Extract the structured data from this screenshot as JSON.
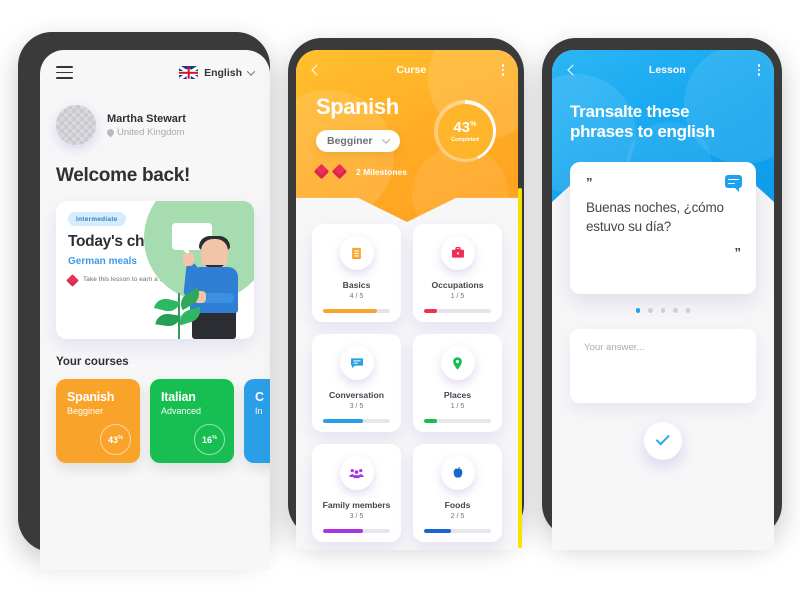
{
  "home": {
    "menu_icon": "hamburger-icon",
    "language": {
      "flag": "uk-flag-icon",
      "label": "English",
      "chevron": "chevron-down-icon"
    },
    "profile": {
      "name": "Martha Stewart",
      "location": "United Kingdom",
      "pin_icon": "location-pin-icon",
      "avatar": "avatar-placeholder"
    },
    "welcome_title": "Welcome back!",
    "challenge": {
      "badge": "Intermediate",
      "title": "Today's challenge",
      "subject": "German meals",
      "note": "Take this lesson to earn a new milestone",
      "note_icon": "gem-icon"
    },
    "courses_title": "Your courses",
    "courses": [
      {
        "name": "Spanish",
        "level": "Begginer",
        "percent": "43",
        "percent_sign": "%",
        "color": "#f9a32b"
      },
      {
        "name": "Italian",
        "level": "Advanced",
        "percent": "16",
        "percent_sign": "%",
        "color": "#17bf53"
      },
      {
        "name": "C",
        "level": "In",
        "percent": "",
        "percent_sign": "",
        "color": "#2a9fe8"
      }
    ]
  },
  "course": {
    "back_icon": "chevron-left-icon",
    "title": "Curse",
    "menu_icon": "more-vertical-icon",
    "language": "Spanish",
    "level": "Begginer",
    "level_chevron": "chevron-down-icon",
    "progress": {
      "percent": "43",
      "percent_sign": "%",
      "label": "Completed",
      "value": 43
    },
    "milestones": {
      "count_label": "2 Milestones",
      "gem_icon": "gem-icon"
    },
    "lessons": [
      {
        "name": "Basics",
        "fraction": "4 / 5",
        "icon": "document-icon",
        "icon_color": "#f9a32b",
        "color": "#f9a32b",
        "value": 80
      },
      {
        "name": "Occupations",
        "fraction": "1 / 5",
        "icon": "briefcase-icon",
        "icon_color": "#ef2f55",
        "color": "#ef2f55",
        "value": 20
      },
      {
        "name": "Conversation",
        "fraction": "3 / 5",
        "icon": "chat-icon",
        "icon_color": "#2a9fe8",
        "color": "#2a9fe8",
        "value": 60
      },
      {
        "name": "Places",
        "fraction": "1 / 5",
        "icon": "location-pin-icon",
        "icon_color": "#17bf53",
        "color": "#17bf53",
        "value": 20
      },
      {
        "name": "Family members",
        "fraction": "3 / 5",
        "icon": "people-icon",
        "icon_color": "#a935e0",
        "color": "#a935e0",
        "value": 60
      },
      {
        "name": "Foods",
        "fraction": "2 / 5",
        "icon": "apple-icon",
        "icon_color": "#1668cf",
        "color": "#1668cf",
        "value": 40
      }
    ]
  },
  "lesson": {
    "back_icon": "chevron-left-icon",
    "title": "Lesson",
    "menu_icon": "more-vertical-icon",
    "instruction": "Transalte these phrases to english",
    "card": {
      "quote_open": "”",
      "quote_close": "”",
      "phrase": "Buenas noches, ¿cómo estuvo su día?",
      "chat_icon": "chat-icon"
    },
    "pagination": {
      "total": 5,
      "active": 1
    },
    "answer_placeholder": "Your answer...",
    "submit_icon": "check-icon"
  },
  "colors": {
    "orange": "#ffab25",
    "blue": "#12a5ef",
    "green": "#17bf53",
    "red": "#ef2f55",
    "yellow_strip": "#f6e500",
    "frame": "#3a3a3a"
  }
}
